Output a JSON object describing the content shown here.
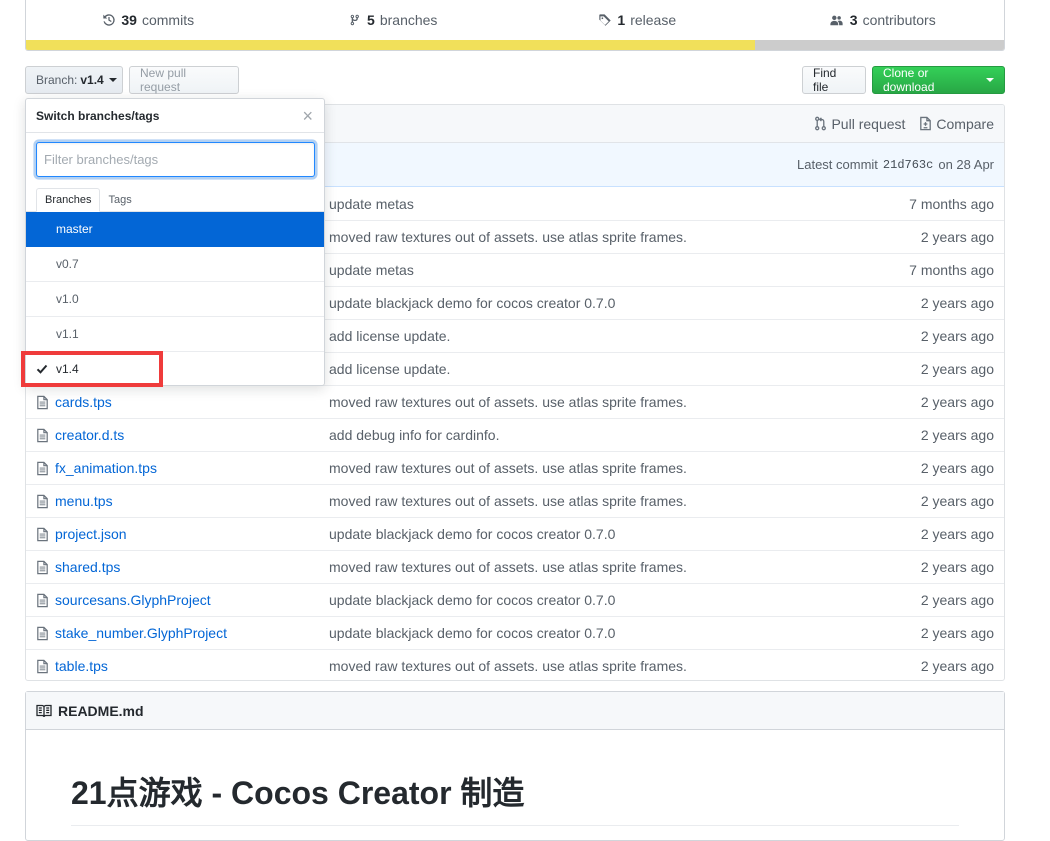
{
  "summary": {
    "commits": {
      "count": "39",
      "label": "commits"
    },
    "branches": {
      "count": "5",
      "label": "branches"
    },
    "releases": {
      "count": "1",
      "label": "release"
    },
    "contributors": {
      "count": "3",
      "label": "contributors"
    }
  },
  "toolbar": {
    "branch_prefix": "Branch:",
    "branch_value": "v1.4",
    "new_pull_request": "New pull request",
    "find_file": "Find file",
    "clone": "Clone or download"
  },
  "file_header": {
    "pull_request": "Pull request",
    "compare": "Compare"
  },
  "commit_tease": {
    "prefix": "Latest commit",
    "sha": "21d763c",
    "date": "on 28 Apr"
  },
  "files": [
    {
      "name": "",
      "message": "update metas",
      "age": "7 months ago"
    },
    {
      "name": "",
      "message": "moved raw textures out of assets. use atlas sprite frames.",
      "age": "2 years ago"
    },
    {
      "name": "",
      "message": "update metas",
      "age": "7 months ago"
    },
    {
      "name": "",
      "message": "update blackjack demo for cocos creator 0.7.0",
      "age": "2 years ago"
    },
    {
      "name": "",
      "message": "add license update.",
      "age": "2 years ago"
    },
    {
      "name": "",
      "message": "add license update.",
      "age": "2 years ago"
    },
    {
      "name": "cards.tps",
      "message": "moved raw textures out of assets. use atlas sprite frames.",
      "age": "2 years ago"
    },
    {
      "name": "creator.d.ts",
      "message": "add debug info for cardinfo.",
      "age": "2 years ago"
    },
    {
      "name": "fx_animation.tps",
      "message": "moved raw textures out of assets. use atlas sprite frames.",
      "age": "2 years ago"
    },
    {
      "name": "menu.tps",
      "message": "moved raw textures out of assets. use atlas sprite frames.",
      "age": "2 years ago"
    },
    {
      "name": "project.json",
      "message": "update blackjack demo for cocos creator 0.7.0",
      "age": "2 years ago"
    },
    {
      "name": "shared.tps",
      "message": "moved raw textures out of assets. use atlas sprite frames.",
      "age": "2 years ago"
    },
    {
      "name": "sourcesans.GlyphProject",
      "message": "update blackjack demo for cocos creator 0.7.0",
      "age": "2 years ago"
    },
    {
      "name": "stake_number.GlyphProject",
      "message": "update blackjack demo for cocos creator 0.7.0",
      "age": "2 years ago"
    },
    {
      "name": "table.tps",
      "message": "moved raw textures out of assets. use atlas sprite frames.",
      "age": "2 years ago"
    }
  ],
  "readme": {
    "filename": "README.md",
    "title": "21点游戏 - Cocos Creator 制造"
  },
  "dropdown": {
    "title": "Switch branches/tags",
    "close": "×",
    "filter_placeholder": "Filter branches/tags",
    "tabs": [
      "Branches",
      "Tags"
    ],
    "branches": [
      "master",
      "v0.7",
      "v1.0",
      "v1.1",
      "v1.4"
    ],
    "highlighted": "master",
    "selected": "v1.4"
  },
  "colors": {
    "link": "#0366d6",
    "clone_green": "#28a745",
    "lang_yellow": "#f1e05a",
    "annotation_red": "#ef3b3b"
  }
}
